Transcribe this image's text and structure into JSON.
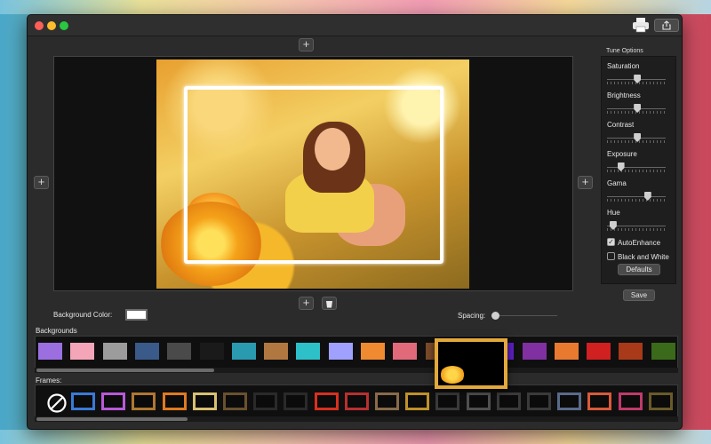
{
  "toolbar": {
    "print_icon": "printer-icon",
    "share_icon": "share-icon"
  },
  "canvas": {
    "add_top": "+",
    "add_left": "+",
    "add_right": "+",
    "add_bottom": "+",
    "delete_icon": "trash-icon"
  },
  "tune": {
    "title": "Tune Options",
    "sliders": [
      {
        "label": "Saturation",
        "value": 0.52
      },
      {
        "label": "Brightness",
        "value": 0.52
      },
      {
        "label": "Contrast",
        "value": 0.52
      },
      {
        "label": "Exposure",
        "value": 0.2
      },
      {
        "label": "Gama",
        "value": 0.72
      },
      {
        "label": "Hue",
        "value": 0.05
      }
    ],
    "auto_enhance": {
      "label": "AutoEnhance",
      "checked": true
    },
    "black_white": {
      "label": "Black and White",
      "checked": false
    },
    "defaults_label": "Defaults",
    "save_label": "Save"
  },
  "background_color": {
    "label": "Background Color:",
    "value": "#ffffff"
  },
  "spacing": {
    "label": "Spacing:",
    "value": 0.0
  },
  "backgrounds": {
    "label": "Backgrounds",
    "swatches": [
      "#9b6fe0",
      "#f4a6b8",
      "#9c9c9c",
      "#3a5a8a",
      "#4a4a4a",
      "#1a1a1a",
      "#2a9ab0",
      "#b07840",
      "#2ec0c8",
      "#a0a0ff",
      "#f08a30",
      "#e06a7a",
      "#7a4a2a",
      "#b82a8a",
      "#5a20c0",
      "#8030a0",
      "#e87a30",
      "#d02020",
      "#a83a1a",
      "#3a6a1a"
    ]
  },
  "frames": {
    "label": "Frames:",
    "none_icon": "no-frame-icon",
    "colors": [
      "#3a7ad8",
      "#b85ad8",
      "#b07830",
      "#e07a20",
      "#d8c070",
      "#6a5030",
      "#2a2a2a",
      "#2a2a2a",
      "#d83020",
      "#b83030",
      "#8a6a4a",
      "#c0902a",
      "#3a3a3a",
      "#505050",
      "#3a3a3a",
      "#3a3a3a",
      "#5a6a8a",
      "#d85a3a",
      "#c03a6a",
      "#6a5a2a"
    ]
  }
}
